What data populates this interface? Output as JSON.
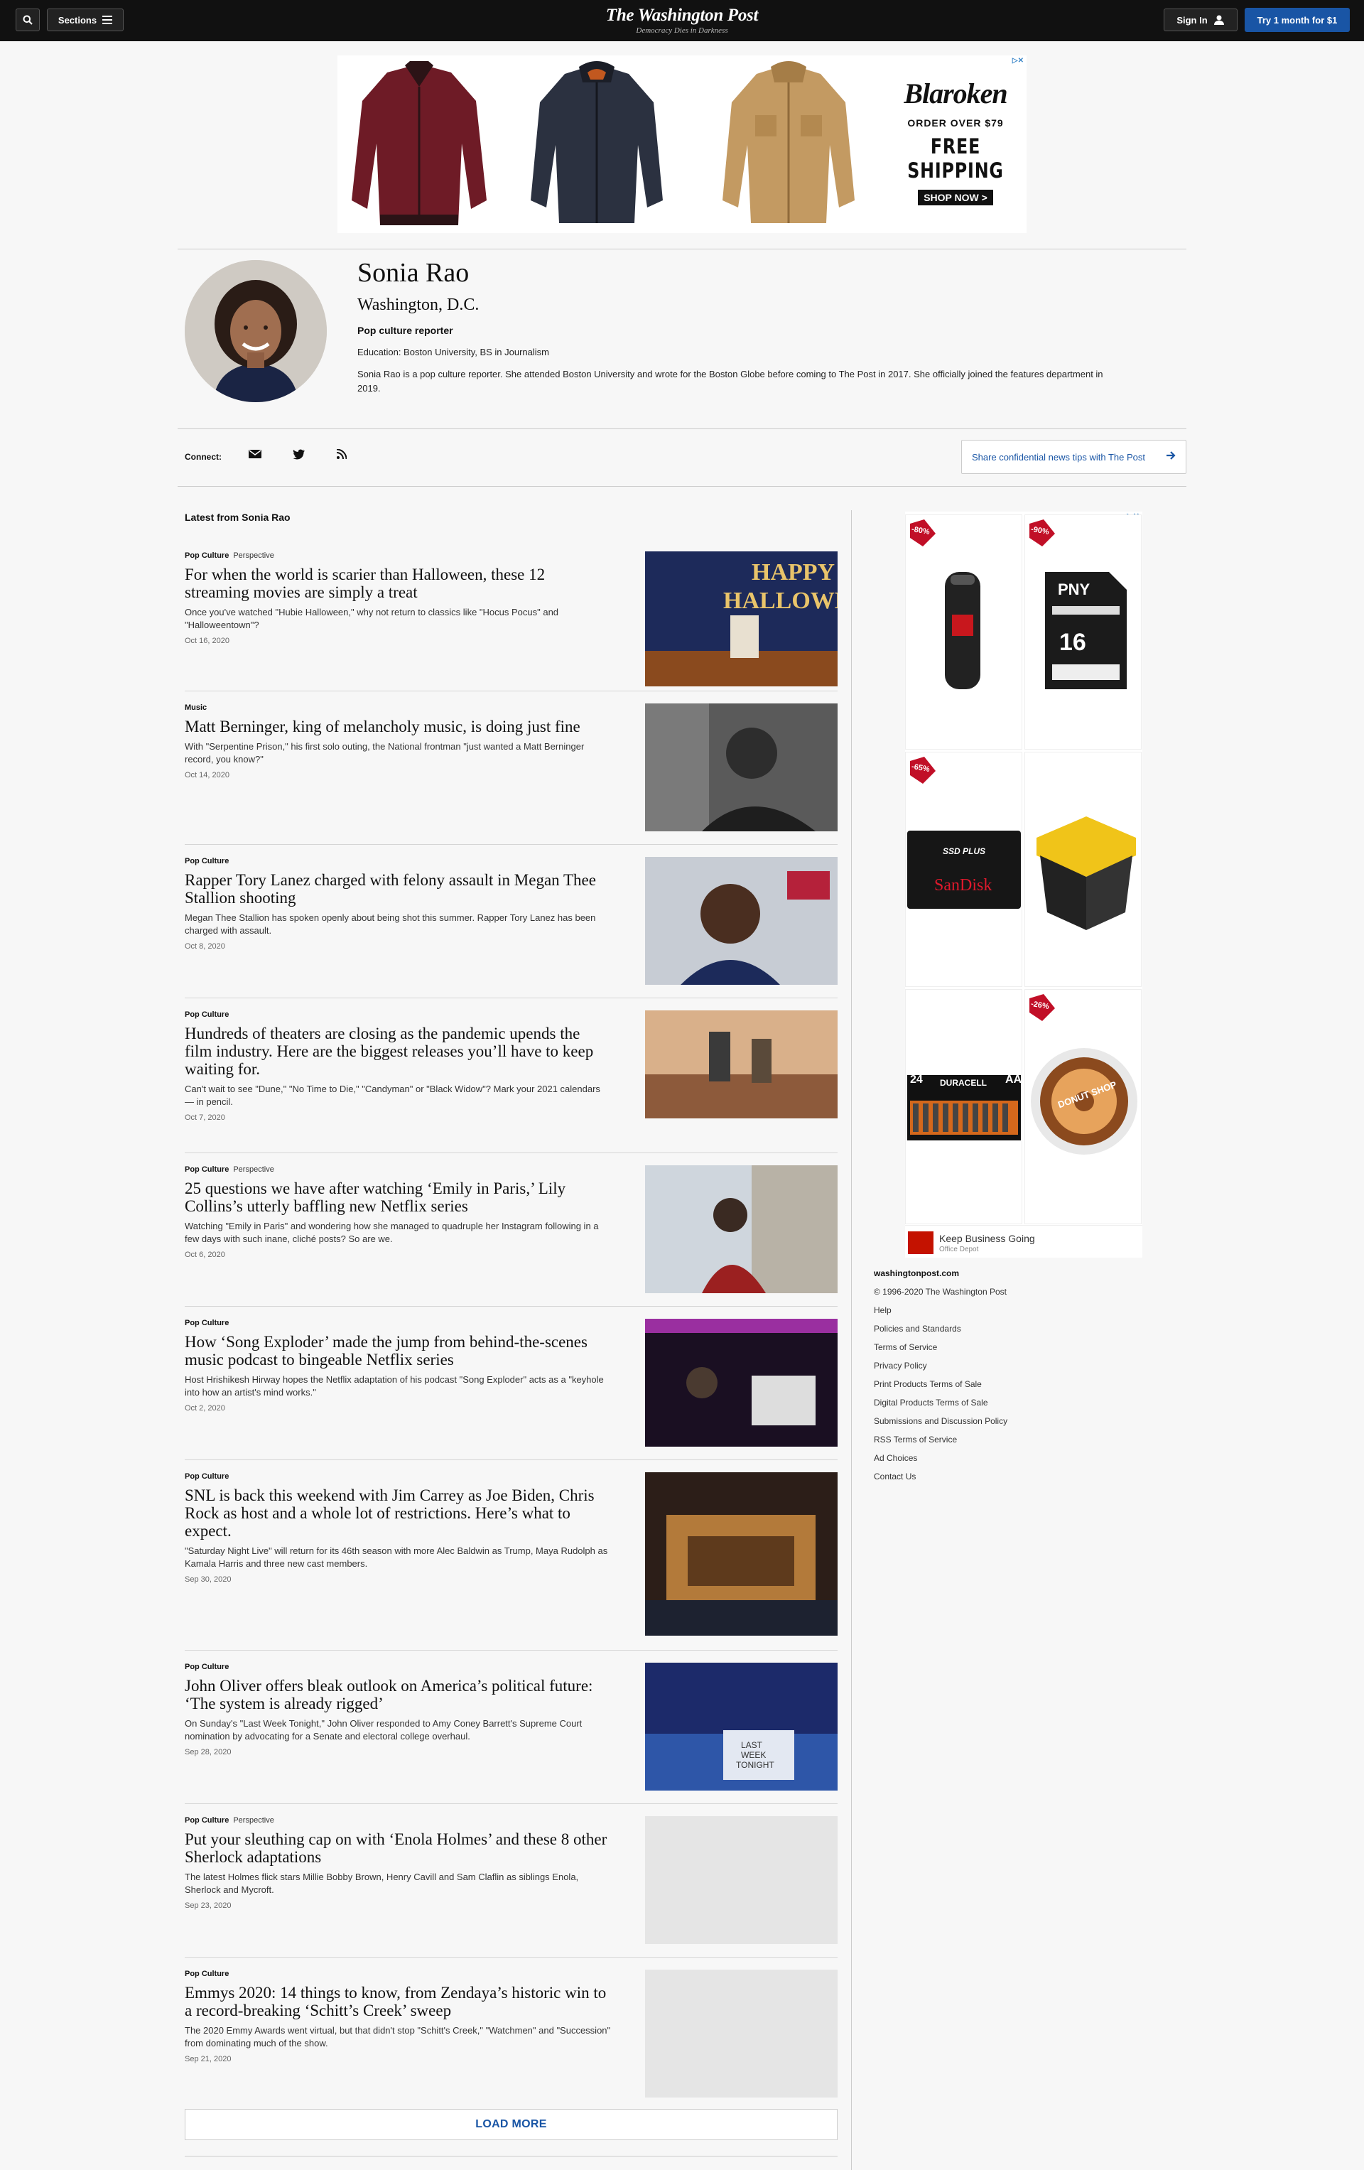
{
  "header": {
    "sections_label": "Sections",
    "logo_title": "The Washington Post",
    "logo_tagline": "Democracy Dies in Darkness",
    "signin_label": "Sign In",
    "subscribe_label": "Try 1 month for $1"
  },
  "top_ad": {
    "brand": "Blaroken",
    "offer": "ORDER OVER $79",
    "shipping": "FREE SHIPPING",
    "cta": "SHOP NOW >"
  },
  "profile": {
    "name": "Sonia Rao",
    "location": "Washington, D.C.",
    "role": "Pop culture reporter",
    "education": "Education: Boston University, BS in Journalism",
    "bio": "Sonia Rao is a pop culture reporter. She attended Boston University and wrote for the Boston Globe before coming to The Post in 2017. She officially joined the features department in 2019."
  },
  "connect": {
    "label": "Connect:",
    "tips_label": "Share confidential news tips with The Post"
  },
  "latest": {
    "heading": "Latest from Sonia Rao",
    "articles": [
      {
        "kicker": "Pop Culture",
        "tag": "Perspective",
        "title": "For when the world is scarier than Halloween, these 12 streaming movies are simply a treat",
        "blurb": "Once you've watched \"Hubie Halloween,\" why not return to classics like \"Hocus Pocus\" and \"Halloweentown\"?",
        "date": "Oct 16, 2020"
      },
      {
        "kicker": "Music",
        "tag": "",
        "title": "Matt Berninger, king of melancholy music, is doing just fine",
        "blurb": "With \"Serpentine Prison,\" his first solo outing, the National frontman \"just wanted a Matt Berninger record, you know?\"",
        "date": "Oct 14, 2020"
      },
      {
        "kicker": "Pop Culture",
        "tag": "",
        "title": "Rapper Tory Lanez charged with felony assault in Megan Thee Stallion shooting",
        "blurb": "Megan Thee Stallion has spoken openly about being shot this summer. Rapper Tory Lanez has been charged with assault.",
        "date": "Oct 8, 2020"
      },
      {
        "kicker": "Pop Culture",
        "tag": "",
        "title": "Hundreds of theaters are closing as the pandemic upends the film industry. Here are the biggest releases you’ll have to keep waiting for.",
        "blurb": "Can't wait to see \"Dune,\" \"No Time to Die,\" \"Candyman\" or \"Black Widow\"? Mark your 2021 calendars — in pencil.",
        "date": "Oct 7, 2020"
      },
      {
        "kicker": "Pop Culture",
        "tag": "Perspective",
        "title": "25 questions we have after watching ‘Emily in Paris,’ Lily Collins’s utterly baffling new Netflix series",
        "blurb": "Watching \"Emily in Paris\" and wondering how she managed to quadruple her Instagram following in a few days with such inane, cliché posts? So are we.",
        "date": "Oct 6, 2020"
      },
      {
        "kicker": "Pop Culture",
        "tag": "",
        "title": "How ‘Song Exploder’ made the jump from behind-the-scenes music podcast to bingeable Netflix series",
        "blurb": "Host Hrishikesh Hirway hopes the Netflix adaptation of his podcast \"Song Exploder\" acts as a \"keyhole into how an artist's mind works.\"",
        "date": "Oct 2, 2020"
      },
      {
        "kicker": "Pop Culture",
        "tag": "",
        "title": "SNL is back this weekend with Jim Carrey as Joe Biden, Chris Rock as host and a whole lot of restrictions. Here’s what to expect.",
        "blurb": "\"Saturday Night Live\" will return for its 46th season with more Alec Baldwin as Trump, Maya Rudolph as Kamala Harris and three new cast members.",
        "date": "Sep 30, 2020"
      },
      {
        "kicker": "Pop Culture",
        "tag": "",
        "title": "John Oliver offers bleak outlook on America’s political future: ‘The system is already rigged’",
        "blurb": "On Sunday's \"Last Week Tonight,\" John Oliver responded to Amy Coney Barrett's Supreme Court nomination by advocating for a Senate and electoral college overhaul.",
        "date": "Sep 28, 2020"
      },
      {
        "kicker": "Pop Culture",
        "tag": "Perspective",
        "title": "Put your sleuthing cap on with ‘Enola Holmes’ and these 8 other Sherlock adaptations",
        "blurb": "The latest Holmes flick stars Millie Bobby Brown, Henry Cavill and Sam Claflin as siblings Enola, Sherlock and Mycroft.",
        "date": "Sep 23, 2020"
      },
      {
        "kicker": "Pop Culture",
        "tag": "",
        "title": "Emmys 2020: 14 things to know, from Zendaya’s historic win to a record-breaking ‘Schitt’s Creek’ sweep",
        "blurb": "The 2020 Emmy Awards went virtual, but that didn't stop \"Schitt's Creek,\" \"Watchmen\" and \"Succession\" from dominating much of the show.",
        "date": "Sep 21, 2020"
      }
    ],
    "load_more": "LOAD MORE"
  },
  "side_ad": {
    "badges": [
      "-80%",
      "-90%",
      "-65%",
      "-26%"
    ],
    "pny_brand": "PNY",
    "pny_size": "16",
    "sandisk_brand": "SanDisk",
    "sandisk_label": "SSD PLUS",
    "duracell_brand": "DURACELL",
    "duracell_count": "24",
    "duracell_type": "AA",
    "donut_label": "DONUT SHOP",
    "bottom_title": "Keep Business Going",
    "bottom_sub": "Office Depot"
  },
  "footer": {
    "site": "washingtonpost.com",
    "copyright": "© 1996-2020 The Washington Post",
    "links": [
      "Help",
      "Policies and Standards",
      "Terms of Service",
      "Privacy Policy",
      "Print Products Terms of Sale",
      "Digital Products Terms of Sale",
      "Submissions and Discussion Policy",
      "RSS Terms of Service",
      "Ad Choices",
      "Contact Us"
    ]
  }
}
